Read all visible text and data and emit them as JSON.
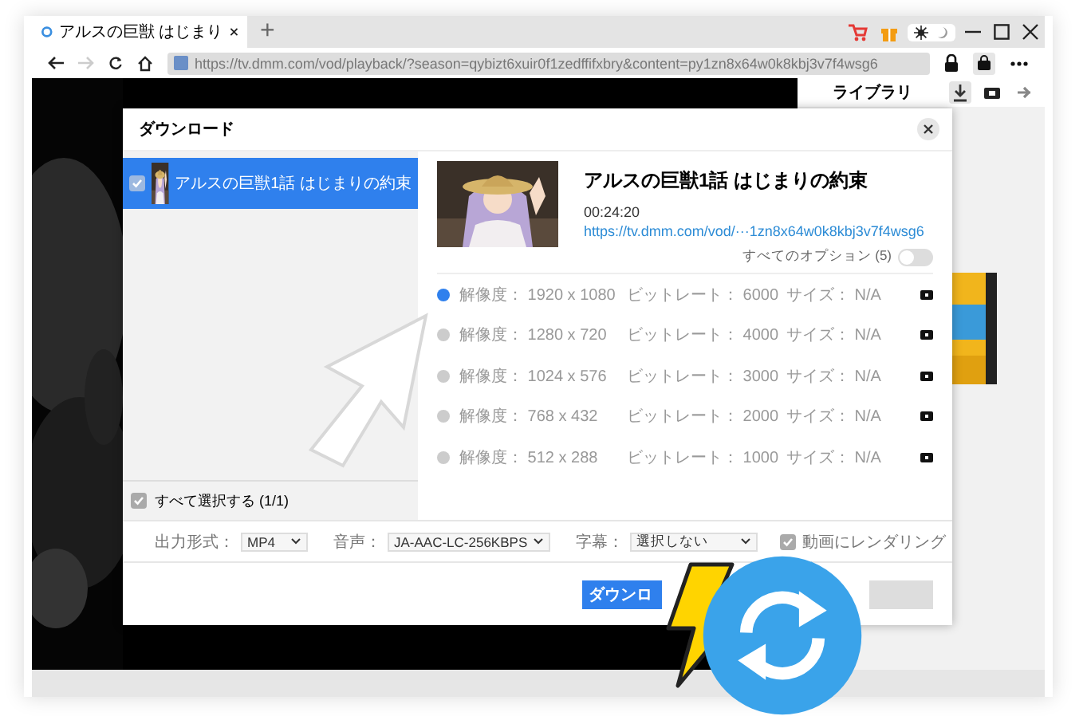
{
  "browser": {
    "tab": {
      "title": "アルスの巨獣 はじまり"
    },
    "new_tab": "+",
    "url": "https://tv.dmm.com/vod/playback/?season=qybizt6xuir0f1zedffifxbry&content=py1zn8x64w0k8kbj3v7f4wsg6",
    "forward": {
      "disabled": true
    },
    "dark_mode": {
      "on": false
    }
  },
  "library": {
    "title": "ライブラリ",
    "tabs": [
      {
        "selected": true
      },
      {
        "selected": false
      },
      {
        "selected": false
      }
    ]
  },
  "dialog": {
    "title": "ダウンロード",
    "items": [
      {
        "title": "アルスの巨獣1話 はじまりの約束",
        "checked": true,
        "selected": true
      }
    ],
    "select_all": {
      "label": "すべて選択する (1/1)",
      "checked": true
    },
    "detail": {
      "title": "アルスの巨獣1話 はじまりの約束",
      "duration": "00:24:20",
      "link": "https://tv.dmm.com/vod/···1zn8x64w0k8kbj3v7f4wsg6",
      "all_options": {
        "label": "すべてのオプション (5)",
        "on": false
      }
    },
    "qualities": [
      {
        "resolution": "解像度： 1920 x 1080",
        "bitrate": "ビットレート： 6000",
        "size": "サイズ： N/A",
        "selected": true
      },
      {
        "resolution": "解像度： 1280 x 720",
        "bitrate": "ビットレート： 4000",
        "size": "サイズ： N/A",
        "selected": false
      },
      {
        "resolution": "解像度： 1024 x 576",
        "bitrate": "ビットレート： 3000",
        "size": "サイズ： N/A",
        "selected": false
      },
      {
        "resolution": "解像度： 768 x 432",
        "bitrate": "ビットレート： 2000",
        "size": "サイズ： N/A",
        "selected": false
      },
      {
        "resolution": "解像度： 512 x 288",
        "bitrate": "ビットレート： 1000",
        "size": "サイズ： N/A",
        "selected": false
      }
    ],
    "output": {
      "format_label": "出力形式：",
      "format": "MP4",
      "audio_label": "音声：",
      "audio": "JA-AAC-LC-256KBPS",
      "subtitle_label": "字幕：",
      "subtitle": "選択しない",
      "render": {
        "label": "動画にレンダリング",
        "checked": true
      }
    },
    "download_button": "ダウンロ"
  }
}
